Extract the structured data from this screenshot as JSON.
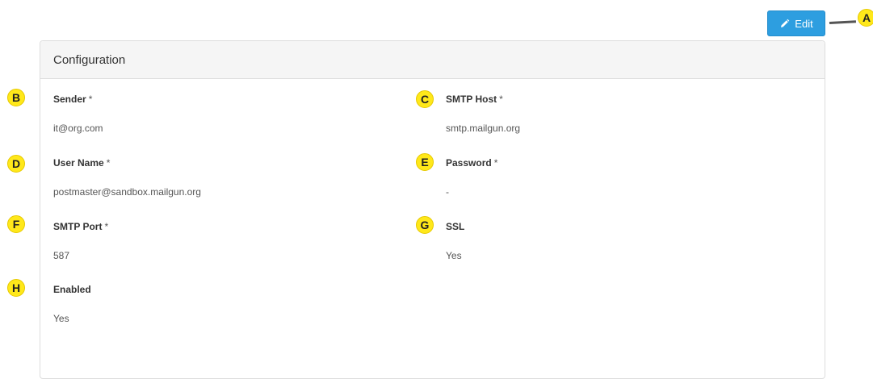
{
  "toolbar": {
    "edit_label": "Edit",
    "edit_icon": "pencil-icon",
    "accent_color": "#2d9ee0"
  },
  "panel": {
    "title": "Configuration"
  },
  "fields": {
    "sender": {
      "label": "Sender",
      "required": "*",
      "value": "it@org.com"
    },
    "smtp_host": {
      "label": "SMTP Host",
      "required": "*",
      "value": "smtp.mailgun.org"
    },
    "user_name": {
      "label": "User Name",
      "required": "*",
      "value": "postmaster@sandbox.mailgun.org"
    },
    "password": {
      "label": "Password",
      "required": "*",
      "value": "-"
    },
    "smtp_port": {
      "label": "SMTP Port",
      "required": "*",
      "value": "587"
    },
    "ssl": {
      "label": "SSL",
      "value": "Yes"
    },
    "enabled": {
      "label": "Enabled",
      "value": "Yes"
    }
  },
  "markers": {
    "a": "A",
    "b": "B",
    "c": "C",
    "d": "D",
    "e": "E",
    "f": "F",
    "g": "G",
    "h": "H",
    "color": "#ffe81a"
  }
}
